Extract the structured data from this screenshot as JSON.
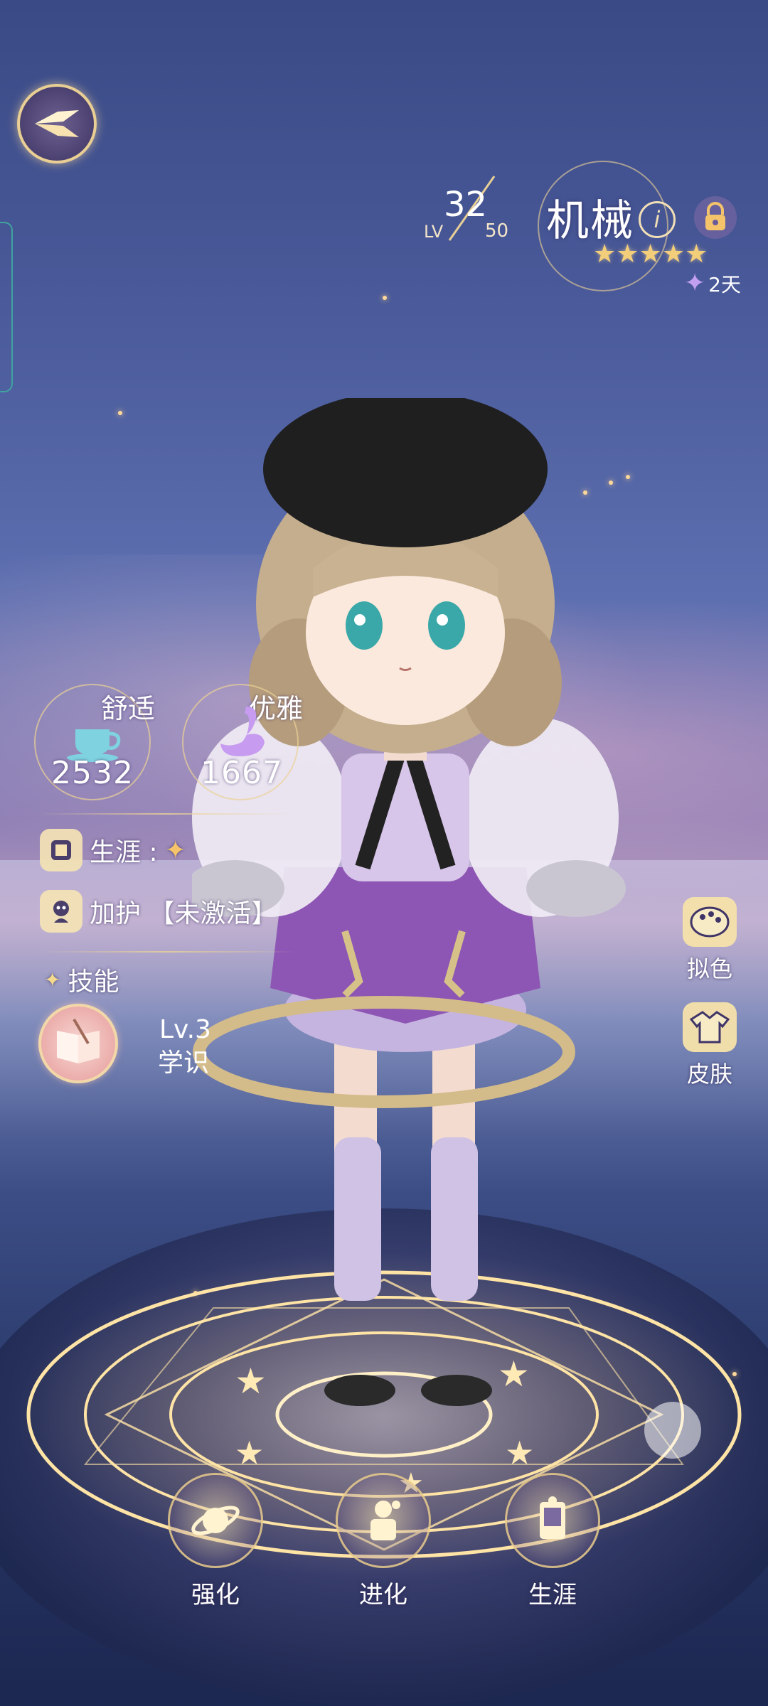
{
  "character": {
    "name": "机械",
    "level_label": "LV",
    "level": "32",
    "level_max": "50",
    "stars": "★★★★★",
    "days_label": "2天"
  },
  "stats": [
    {
      "label": "舒适",
      "value": "2532"
    },
    {
      "label": "优雅",
      "value": "1667"
    }
  ],
  "rows": {
    "career": "生涯 :",
    "blessing": "加护 【未激活】",
    "skills_header": "技能"
  },
  "skill": {
    "level": "Lv.3",
    "name": "学识"
  },
  "right_actions": [
    {
      "label": "拟色",
      "icon": "palette-icon"
    },
    {
      "label": "皮肤",
      "icon": "outfit-icon"
    }
  ],
  "bottom_actions": [
    {
      "label": "强化",
      "icon": "planet-icon"
    },
    {
      "label": "进化",
      "icon": "evolve-icon"
    },
    {
      "label": "生涯",
      "icon": "career-book-icon"
    }
  ],
  "colors": {
    "accent_gold": "#e9cf94",
    "star_gold": "#f2cd7a",
    "sky_top": "#3a4a86",
    "floor_dark": "#1c2750"
  }
}
